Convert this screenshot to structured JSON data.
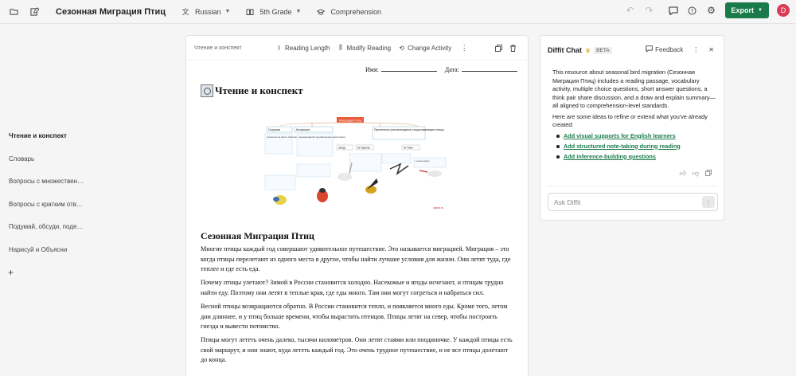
{
  "header": {
    "title": "Сезонная Миграция Птиц",
    "language": "Russian",
    "grade": "5th Grade",
    "skill": "Comprehension",
    "export_label": "Export",
    "avatar_letter": "D"
  },
  "sidebar": {
    "items": [
      {
        "label": "Чтение и конспект",
        "active": true
      },
      {
        "label": "Словарь"
      },
      {
        "label": "Вопросы с множественным выбором"
      },
      {
        "label": "Вопросы с кратким ответом"
      },
      {
        "label": "Подумай, обсуди, поделись"
      },
      {
        "label": "Нарисуй и Объясни"
      }
    ],
    "add_label": "+"
  },
  "document": {
    "crumb": "Чтение и конспект",
    "tools": {
      "reading_length": "Reading Length",
      "modify_reading": "Modify Reading",
      "change_activity": "Change Activity"
    },
    "name_label": "Имя:",
    "date_label": "Дата:",
    "section_heading": "Чтение и конспект",
    "reading_title": "Сезонная Миграция Птиц",
    "paragraphs": [
      "Многие птицы каждый год совершают удивительное путешествие. Это называется миграцией. Миграция – это когда птицы перелетают из одного места в другое, чтобы найти лучшие условия для жизни. Они летят туда, где теплее и где есть еда.",
      "Почему птицы улетают? Зимой в России становится холодно. Насекомые и ягоды исчезают, и птицам трудно найти еду. Поэтому они летят в теплые края, где еды много. Там они могут согреться и набраться сил.",
      "Весной птицы возвращаются обратно. В России становится тепло, и появляется много еды. Кроме того, летом дни длиннее, и у птиц больше времени, чтобы вырастить птенцов. Птицы летят на север, чтобы построить гнезда и вывести потомство.",
      "Птицы могут лететь очень далеко, тысячи километров. Они летят стаями или поодиночке. У каждой птицы есть свой маршрут, и они знают, куда лететь каждый год. Это очень трудное путешествие, и не все птицы долетают до конца."
    ],
    "figure": {
      "title": "Миграция птиц",
      "col1": "Оседлые",
      "col2": "Кочующие",
      "col3": "Перелетные (насекомоядные и водоплавающие птицы)",
      "col1_note": "остаются на месте обитания",
      "col2_note": "перемещаются на небольшие расстояния",
      "col3_a": "запад",
      "col3_b": "юг Европы",
      "col3_c": "юг Азии",
      "col4": "теплые края",
      "watermark": "ogivio.ru"
    }
  },
  "chat": {
    "title": "Diffit Chat",
    "beta": "BETA",
    "feedback": "Feedback",
    "message_intro": "This resource about seasonal bird migration (Сезонная Миграция Птиц) includes a reading passage, vocabulary activity, multiple choice questions, short answer questions, a think pair share discussion, and a draw and explain summary—all aligned to comprehension-level standards.",
    "message_ideas": "Here are some ideas to refine or extend what you've already created:",
    "suggestions": [
      "Add visual supports for English learners",
      "Add structured note-taking during reading",
      "Add inference-building questions"
    ],
    "input_placeholder": "Ask Diffit"
  },
  "colors": {
    "accent_green": "#1a7a4a",
    "avatar_red": "#d93d56",
    "crown_gold": "#e0a317"
  }
}
